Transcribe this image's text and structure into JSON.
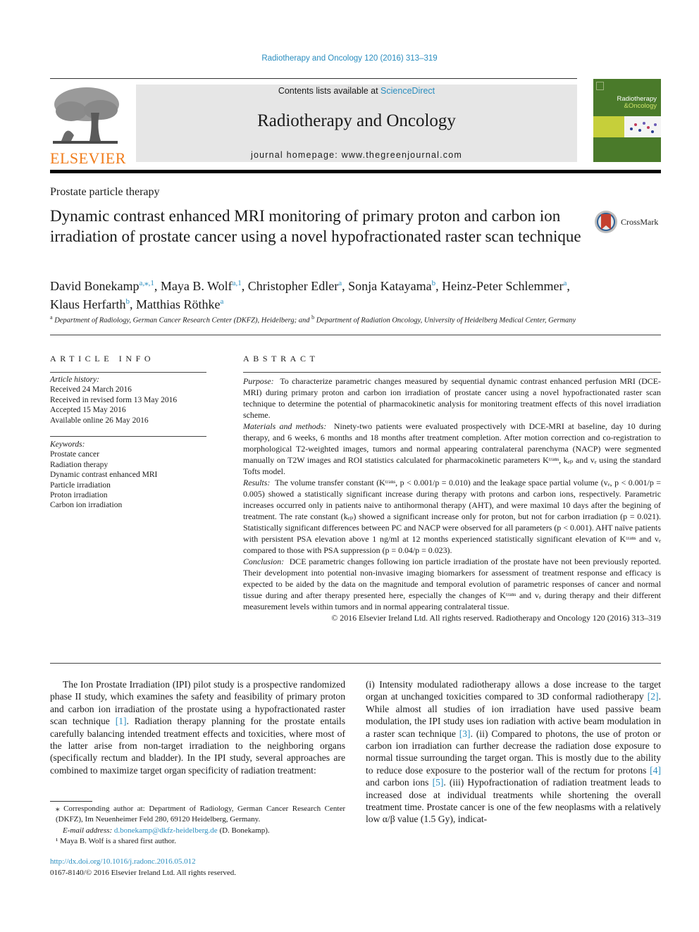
{
  "header": {
    "journal_ref": "Radiotherapy and Oncology 120 (2016) 313–319",
    "publisher_logo_text": "ELSEVIER",
    "contents_prefix": "Contents lists available at ",
    "contents_link": "ScienceDirect",
    "journal_title": "Radiotherapy and Oncology",
    "homepage": "journal homepage: www.thegreenjournal.com",
    "cover_title_line1": "Radiotherapy",
    "cover_title_line2": "&Oncology",
    "colors": {
      "link": "#2a8dbf",
      "elsevier_orange": "#f07c1b",
      "cover_green": "#4a7a2a",
      "banner_gray": "#e6e6e6"
    }
  },
  "article": {
    "section": "Prostate particle therapy",
    "title": "Dynamic contrast enhanced MRI monitoring of primary proton and carbon ion irradiation of prostate cancer using a novel hypofractionated raster scan technique",
    "crossmark_label": "CrossMark",
    "authors": [
      {
        "name": "David Bonekamp",
        "sup": "a,⁎,1",
        "sep": ", "
      },
      {
        "name": "Maya B. Wolf",
        "sup": "a,1",
        "sep": ", "
      },
      {
        "name": "Christopher Edler",
        "sup": "a",
        "sep": ", "
      },
      {
        "name": "Sonja Katayama",
        "sup": "b",
        "sep": ", "
      },
      {
        "name": "Heinz-Peter Schlemmer",
        "sup": "a",
        "sep": ","
      },
      {
        "name": "Klaus Herfarth",
        "sup": "b",
        "sep": ", "
      },
      {
        "name": "Matthias Röthke",
        "sup": "a",
        "sep": ""
      }
    ],
    "affiliations": {
      "a_mark": "a",
      "a_text": " Department of Radiology, German Cancer Research Center (DKFZ), Heidelberg; and ",
      "b_mark": "b",
      "b_text": " Department of Radiation Oncology, University of Heidelberg Medical Center, Germany"
    }
  },
  "article_info": {
    "heading": "ARTICLE INFO",
    "history_label": "Article history:",
    "history": [
      "Received 24 March 2016",
      "Received in revised form 13 May 2016",
      "Accepted 15 May 2016",
      "Available online 26 May 2016"
    ],
    "keywords_label": "Keywords:",
    "keywords": [
      "Prostate cancer",
      "Radiation therapy",
      "Dynamic contrast enhanced MRI",
      "Particle irradiation",
      "Proton irradiation",
      "Carbon ion irradiation"
    ]
  },
  "abstract": {
    "heading": "ABSTRACT",
    "purpose_label": "Purpose:",
    "purpose": "To characterize parametric changes measured by sequential dynamic contrast enhanced perfusion MRI (DCE-MRI) during primary proton and carbon ion irradiation of prostate cancer using a novel hypofractionated raster scan technique to determine the potential of pharmacokinetic analysis for monitoring treatment effects of this novel irradiation scheme.",
    "methods_label": "Materials and methods:",
    "methods": "Ninety-two patients were evaluated prospectively with DCE-MRI at baseline, day 10 during therapy, and 6 weeks, 6 months and 18 months after treatment completion. After motion correction and co-registration to morphological T2-weighted images, tumors and normal appearing contralateral parenchyma (NACP) were segmented manually on T2W images and ROI statistics calculated for pharmacokinetic parameters Kᵗʳᵃⁿˢ, kₑₚ and vₑ using the standard Tofts model.",
    "results_label": "Results:",
    "results": "The volume transfer constant (Kᵗʳᵃⁿˢ, p < 0.001/p = 0.010) and the leakage space partial volume (vₑ, p < 0.001/p = 0.005) showed a statistically significant increase during therapy with protons and carbon ions, respectively. Parametric increases occurred only in patients naive to antihormonal therapy (AHT), and were maximal 10 days after the begining of treatment. The rate constant (kₑₚ) showed a significant increase only for proton, but not for carbon irradiation (p = 0.021). Statistically significant differences between PC and NACP were observed for all parameters (p < 0.001). AHT naïve patients with persistent PSA elevation above 1 ng/ml at 12 months experienced statistically significant elevation of Kᵗʳᵃⁿˢ and vₑ compared to those with PSA suppression (p = 0.04/p = 0.023).",
    "conclusion_label": "Conclusion:",
    "conclusion": "DCE parametric changes following ion particle irradiation of the prostate have not been previously reported. Their development into potential non-invasive imaging biomarkers for assessment of treatment response and efficacy is expected to be aided by the data on the magnitude and temporal evolution of parametric responses of cancer and normal tissue during and after therapy presented here, especially the changes of Kᵗʳᵃⁿˢ and vₑ during therapy and their different measurement levels within tumors and in normal appearing contralateral tissue.",
    "copyright": "© 2016 Elsevier Ireland Ltd. All rights reserved. Radiotherapy and Oncology 120 (2016) 313–319"
  },
  "body": {
    "left_p1_a": "The Ion Prostate Irradiation (IPI) pilot study is a prospective randomized phase II study, which examines the safety and feasibility of primary proton and carbon ion irradiation of the prostate using a hypofractionated raster scan technique ",
    "ref1": "[1]",
    "left_p1_b": ". Radiation therapy planning for the prostate entails carefully balancing intended treatment effects and toxicities, where most of the latter arise from non-target irradiation to the neighboring organs (specifically rectum and bladder). In the IPI study, several approaches are combined to maximize target organ specificity of radiation treatment:",
    "right_a": "(i) Intensity modulated radiotherapy allows a dose increase to the target organ at unchanged toxicities compared to 3D conformal radiotherapy ",
    "ref2": "[2]",
    "right_b": ". While almost all studies of ion irradiation have used passive beam modulation, the IPI study uses ion radiation with active beam modulation in a raster scan technique ",
    "ref3": "[3]",
    "right_c": ". (ii) Compared to photons, the use of proton or carbon ion irradiation can further decrease the radiation dose exposure to normal tissue surrounding the target organ. This is mostly due to the ability to reduce dose exposure to the posterior wall of the rectum for protons ",
    "ref4": "[4]",
    "right_d": " and carbon ions ",
    "ref5": "[5]",
    "right_e": ". (iii) Hypofractionation of radiation treatment leads to increased dose at individual treatments while shortening the overall treatment time. Prostate cancer is one of the few neoplasms with a relatively low α/β value (1.5 Gy), indicat-"
  },
  "footnotes": {
    "corresponding": "⁎ Corresponding author at: Department of Radiology, German Cancer Research Center (DKFZ), Im Neuenheimer Feld 280, 69120 Heidelberg, Germany.",
    "email_label": "E-mail address: ",
    "email": "d.bonekamp@dkfz-heidelberg.de",
    "email_suffix": " (D. Bonekamp).",
    "shared": "¹  Maya B. Wolf is a shared first author.",
    "doi": "http://dx.doi.org/10.1016/j.radonc.2016.05.012",
    "issn": "0167-8140/© 2016 Elsevier Ireland Ltd. All rights reserved."
  }
}
